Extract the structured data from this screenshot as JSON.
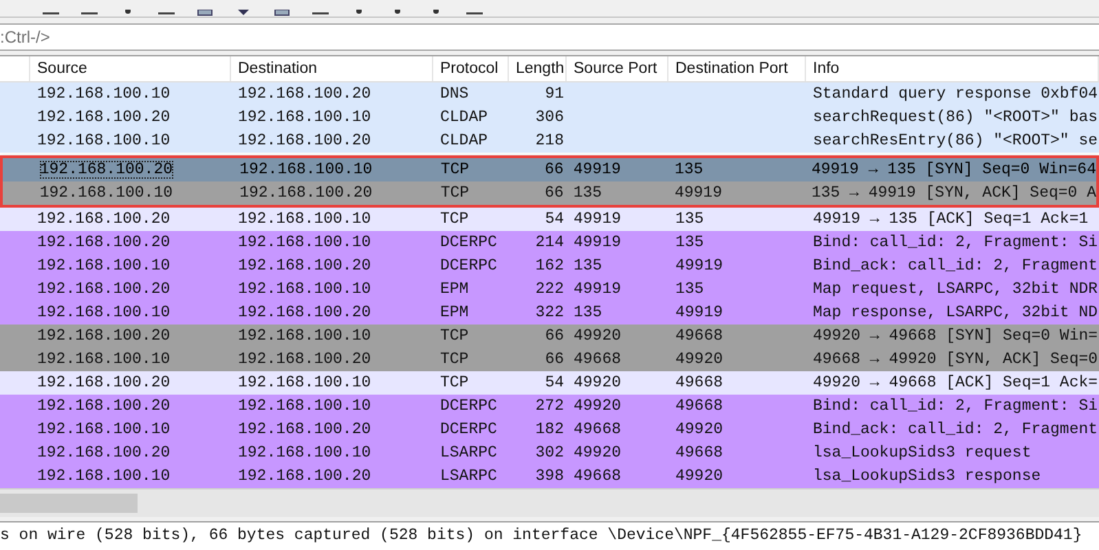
{
  "filter": {
    "placeholder": ":Ctrl-/>"
  },
  "columns": [
    "Source",
    "Destination",
    "Protocol",
    "Length",
    "Source Port",
    "Destination Port",
    "Info"
  ],
  "rows": [
    {
      "cells": [
        "192.168.100.10",
        "192.168.100.20",
        "DNS",
        "91",
        "",
        "",
        "Standard query response 0xbf04"
      ],
      "color": "#dae8fc",
      "selected": false,
      "boxed": false
    },
    {
      "cells": [
        "192.168.100.20",
        "192.168.100.10",
        "CLDAP",
        "306",
        "",
        "",
        "searchRequest(86) \"<ROOT>\" bas"
      ],
      "color": "#dae8fc",
      "selected": false,
      "boxed": false
    },
    {
      "cells": [
        "192.168.100.10",
        "192.168.100.20",
        "CLDAP",
        "218",
        "",
        "",
        "searchResEntry(86) \"<ROOT>\" se"
      ],
      "color": "#dae8fc",
      "selected": false,
      "boxed": false
    },
    {
      "cells": [
        "192.168.100.20",
        "192.168.100.10",
        "TCP",
        "66",
        "49919",
        "135",
        "49919 → 135 [SYN] Seq=0 Win=64"
      ],
      "color": "#7d94aa",
      "selected": true,
      "boxed": true
    },
    {
      "cells": [
        "192.168.100.10",
        "192.168.100.20",
        "TCP",
        "66",
        "135",
        "49919",
        "135 → 49919 [SYN, ACK] Seq=0 A"
      ],
      "color": "#a0a0a0",
      "selected": false,
      "boxed": true
    },
    {
      "cells": [
        "192.168.100.20",
        "192.168.100.10",
        "TCP",
        "54",
        "49919",
        "135",
        "49919 → 135 [ACK] Seq=1 Ack=1"
      ],
      "color": "#e7e6ff",
      "selected": false,
      "boxed": false
    },
    {
      "cells": [
        "192.168.100.20",
        "192.168.100.10",
        "DCERPC",
        "214",
        "49919",
        "135",
        "Bind: call_id: 2, Fragment: Si"
      ],
      "color": "#c797ff",
      "selected": false,
      "boxed": false
    },
    {
      "cells": [
        "192.168.100.10",
        "192.168.100.20",
        "DCERPC",
        "162",
        "135",
        "49919",
        "Bind_ack: call_id: 2, Fragment"
      ],
      "color": "#c797ff",
      "selected": false,
      "boxed": false
    },
    {
      "cells": [
        "192.168.100.20",
        "192.168.100.10",
        "EPM",
        "222",
        "49919",
        "135",
        "Map request, LSARPC, 32bit NDR"
      ],
      "color": "#c797ff",
      "selected": false,
      "boxed": false
    },
    {
      "cells": [
        "192.168.100.10",
        "192.168.100.20",
        "EPM",
        "322",
        "135",
        "49919",
        "Map response, LSARPC, 32bit ND"
      ],
      "color": "#c797ff",
      "selected": false,
      "boxed": false
    },
    {
      "cells": [
        "192.168.100.20",
        "192.168.100.10",
        "TCP",
        "66",
        "49920",
        "49668",
        "49920 → 49668 [SYN] Seq=0 Win="
      ],
      "color": "#a0a0a0",
      "selected": false,
      "boxed": false
    },
    {
      "cells": [
        "192.168.100.10",
        "192.168.100.20",
        "TCP",
        "66",
        "49668",
        "49920",
        "49668 → 49920 [SYN, ACK] Seq=0"
      ],
      "color": "#a0a0a0",
      "selected": false,
      "boxed": false
    },
    {
      "cells": [
        "192.168.100.20",
        "192.168.100.10",
        "TCP",
        "54",
        "49920",
        "49668",
        "49920 → 49668 [ACK] Seq=1 Ack="
      ],
      "color": "#e7e6ff",
      "selected": false,
      "boxed": false
    },
    {
      "cells": [
        "192.168.100.20",
        "192.168.100.10",
        "DCERPC",
        "272",
        "49920",
        "49668",
        "Bind: call_id: 2, Fragment: Si"
      ],
      "color": "#c797ff",
      "selected": false,
      "boxed": false
    },
    {
      "cells": [
        "192.168.100.10",
        "192.168.100.20",
        "DCERPC",
        "182",
        "49668",
        "49920",
        "Bind_ack: call_id: 2, Fragment"
      ],
      "color": "#c797ff",
      "selected": false,
      "boxed": false
    },
    {
      "cells": [
        "192.168.100.20",
        "192.168.100.10",
        "LSARPC",
        "302",
        "49920",
        "49668",
        "lsa_LookupSids3 request"
      ],
      "color": "#c797ff",
      "selected": false,
      "boxed": false
    },
    {
      "cells": [
        "192.168.100.10",
        "192.168.100.20",
        "LSARPC",
        "398",
        "49668",
        "49920",
        "lsa_LookupSids3 response"
      ],
      "color": "#c797ff",
      "selected": false,
      "boxed": false
    }
  ],
  "details": [
    "s on wire (528 bits), 66 bytes captured (528 bits) on interface \\Device\\NPF_{4F562855-EF75-4B31-A129-2CF8936BDD41}"
  ]
}
